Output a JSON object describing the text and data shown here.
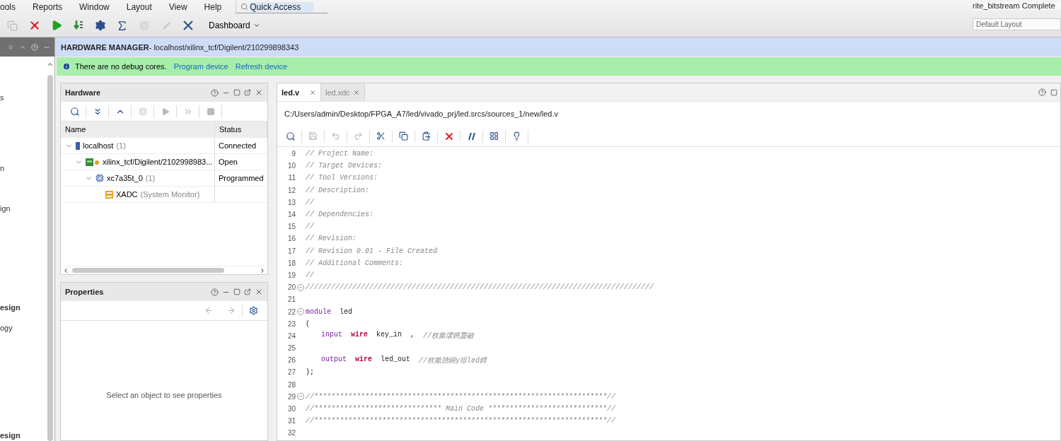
{
  "menu": [
    {
      "label": "ools"
    },
    {
      "label": "Reports"
    },
    {
      "label": "Window"
    },
    {
      "label": "Layout"
    },
    {
      "label": "View"
    },
    {
      "label": "Help"
    }
  ],
  "quick_access": {
    "placeholder": "Quick Access"
  },
  "toolbar": {
    "dashboard": "Dashboard"
  },
  "status": {
    "run_status": "rite_bitstream Complete",
    "layout": "Default Layout"
  },
  "flow_navigator": {
    "items": [
      "s",
      "n",
      "ign",
      "esign",
      "ogy",
      "esign"
    ]
  },
  "header": {
    "title": "HARDWARE MANAGER",
    "path": " - localhost/xilinx_tcf/Digilent/210299898343"
  },
  "info_bar": {
    "message": "There are no debug cores.",
    "links": [
      "Program device",
      "Refresh device"
    ]
  },
  "hardware": {
    "title": "Hardware",
    "columns": [
      "Name",
      "Status"
    ],
    "tree": [
      {
        "kind": "host",
        "name": "localhost",
        "count": "(1)",
        "status": "Connected",
        "expanded": true,
        "children": [
          {
            "kind": "board",
            "name": "xilinx_tcf/Digilent/2102998983...",
            "status": "Open",
            "expanded": true,
            "children": [
              {
                "kind": "chip",
                "name": "xc7a35t_0",
                "count": "(1)",
                "status": "Programmed",
                "expanded": true,
                "children": [
                  {
                    "kind": "xadc",
                    "name": "XADC",
                    "count": "(System Monitor)"
                  }
                ]
              }
            ]
          }
        ]
      }
    ]
  },
  "properties": {
    "title": "Properties",
    "empty": "Select an object to see properties"
  },
  "editor": {
    "tabs": [
      {
        "label": "led.v",
        "selected": true
      },
      {
        "label": "led.xdc",
        "selected": false
      }
    ],
    "path": "C:/Users/admin/Desktop/FPGA_A7/led/vivado_prj/led.srcs/sources_1/new/led.v",
    "lines": [
      {
        "num": "9",
        "tokens": [
          {
            "kind": "comment",
            "text": "// Project Name:"
          }
        ]
      },
      {
        "num": "10",
        "tokens": [
          {
            "kind": "comment",
            "text": "// Target Devices:"
          }
        ]
      },
      {
        "num": "11",
        "tokens": [
          {
            "kind": "comment",
            "text": "// Tool Versions:"
          }
        ]
      },
      {
        "num": "12",
        "tokens": [
          {
            "kind": "comment",
            "text": "// Description:"
          }
        ]
      },
      {
        "num": "13",
        "tokens": [
          {
            "kind": "comment",
            "text": "//"
          }
        ]
      },
      {
        "num": "14",
        "tokens": [
          {
            "kind": "comment",
            "text": "// Dependencies:"
          }
        ]
      },
      {
        "num": "15",
        "tokens": [
          {
            "kind": "comment",
            "text": "//"
          }
        ]
      },
      {
        "num": "16",
        "tokens": [
          {
            "kind": "comment",
            "text": "// Revision:"
          }
        ]
      },
      {
        "num": "17",
        "tokens": [
          {
            "kind": "comment",
            "text": "// Revision 0.01 - File Created"
          }
        ]
      },
      {
        "num": "18",
        "tokens": [
          {
            "kind": "comment",
            "text": "// Additional Comments:"
          }
        ]
      },
      {
        "num": "19",
        "tokens": [
          {
            "kind": "comment",
            "text": "//"
          }
        ]
      },
      {
        "num": "20",
        "fold": true,
        "tokens": [
          {
            "kind": "comment",
            "text": "//////////////////////////////////////////////////////////////////////////////////"
          }
        ]
      },
      {
        "num": "21"
      },
      {
        "num": "22",
        "fold": true,
        "tokens": [
          {
            "kind": "keyword",
            "text": "module"
          },
          {
            "kind": "plain",
            "text": "led"
          }
        ]
      },
      {
        "num": "23",
        "tokens": [
          {
            "kind": "plain",
            "text": "("
          }
        ]
      },
      {
        "num": "24",
        "indented": true,
        "tokens": [
          {
            "kind": "keyword",
            "text": "input"
          },
          {
            "kind": "type",
            "text": "wire"
          },
          {
            "kind": "plain",
            "text": "key_in"
          },
          {
            "kind": "plain",
            "text": ","
          },
          {
            "kind": "comment",
            "text": "//杈撳叆鎸夐敭"
          }
        ]
      },
      {
        "num": "25"
      },
      {
        "num": "26",
        "indented": true,
        "tokens": [
          {
            "kind": "keyword",
            "text": "output"
          },
          {
            "kind": "type",
            "text": "wire"
          },
          {
            "kind": "plain",
            "text": "led_out"
          },
          {
            "kind": "comment",
            "text": "//杈撳嚭鎺у埗led鐏"
          }
        ]
      },
      {
        "num": "27",
        "tokens": [
          {
            "kind": "plain",
            "text": ");"
          }
        ]
      },
      {
        "num": "28"
      },
      {
        "num": "29",
        "fold": true,
        "tokens": [
          {
            "kind": "comment",
            "text": "//*********************************************************************//"
          }
        ]
      },
      {
        "num": "30",
        "tokens": [
          {
            "kind": "comment",
            "text": "//****************************** Main Code ****************************//"
          }
        ]
      },
      {
        "num": "31",
        "tokens": [
          {
            "kind": "comment",
            "text": "//*********************************************************************//"
          }
        ]
      },
      {
        "num": "32"
      }
    ]
  }
}
